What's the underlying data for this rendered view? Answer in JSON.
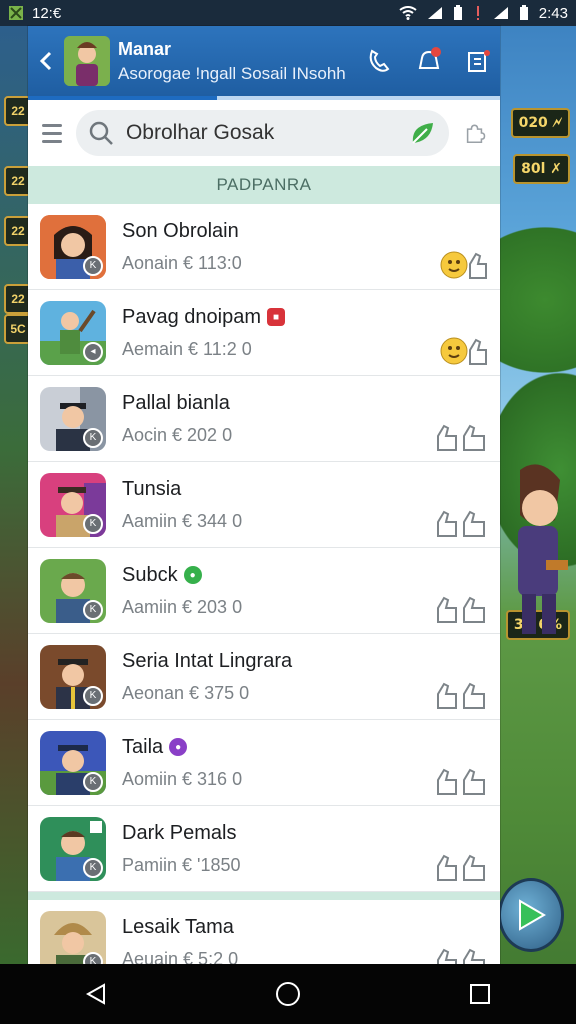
{
  "status_bar": {
    "time": "12:€",
    "right_text": "2:43"
  },
  "header": {
    "title": "Manar",
    "subtitle": "Asorogae !ngall Sosail INsohh",
    "progress": 0.4
  },
  "search": {
    "value": "Obrolhar Gosak"
  },
  "section": {
    "title": "PADPANRA"
  },
  "contacts": [
    {
      "name": "Son Obrolain",
      "meta": "Aonain € 113:0",
      "badge": "",
      "react": "emoji"
    },
    {
      "name": "Pavag dnoipam",
      "meta": "Aemain € 11:2 0",
      "badge": "red",
      "react": "emoji"
    },
    {
      "name": "Pallal bianla",
      "meta": "Aocin € 202 0",
      "badge": "",
      "react": "outline"
    },
    {
      "name": "Tunsia",
      "meta": "Aamiin € 344 0",
      "badge": "",
      "react": "outline"
    },
    {
      "name": "Subck",
      "meta": "Aamiin € 203 0",
      "badge": "green",
      "react": "outline"
    },
    {
      "name": "Seria Intat Lingrara",
      "meta": "Aeonan € 375 0",
      "badge": "",
      "react": "outline"
    },
    {
      "name": "Taila",
      "meta": "Aomiin € 316 0",
      "badge": "purple",
      "react": "outline"
    },
    {
      "name": "Dark Pemals",
      "meta": "Pamiin € '1850",
      "badge": "",
      "react": "outline"
    }
  ],
  "contacts_more": [
    {
      "name": "Lesaik Tama",
      "meta": "Aeuain € 5:2 0",
      "badge": "",
      "react": "outline"
    }
  ],
  "game_hud": {
    "left_chips": [
      "22",
      "22",
      "22",
      "22",
      "5C"
    ],
    "right_top": "020 🗲",
    "right_mid": "80l ✗",
    "right_low": "36 6%"
  },
  "colors": {
    "header_blue": "#1f5ea2",
    "section_mint": "#cde9de",
    "search_leaf": "#3fae49"
  }
}
